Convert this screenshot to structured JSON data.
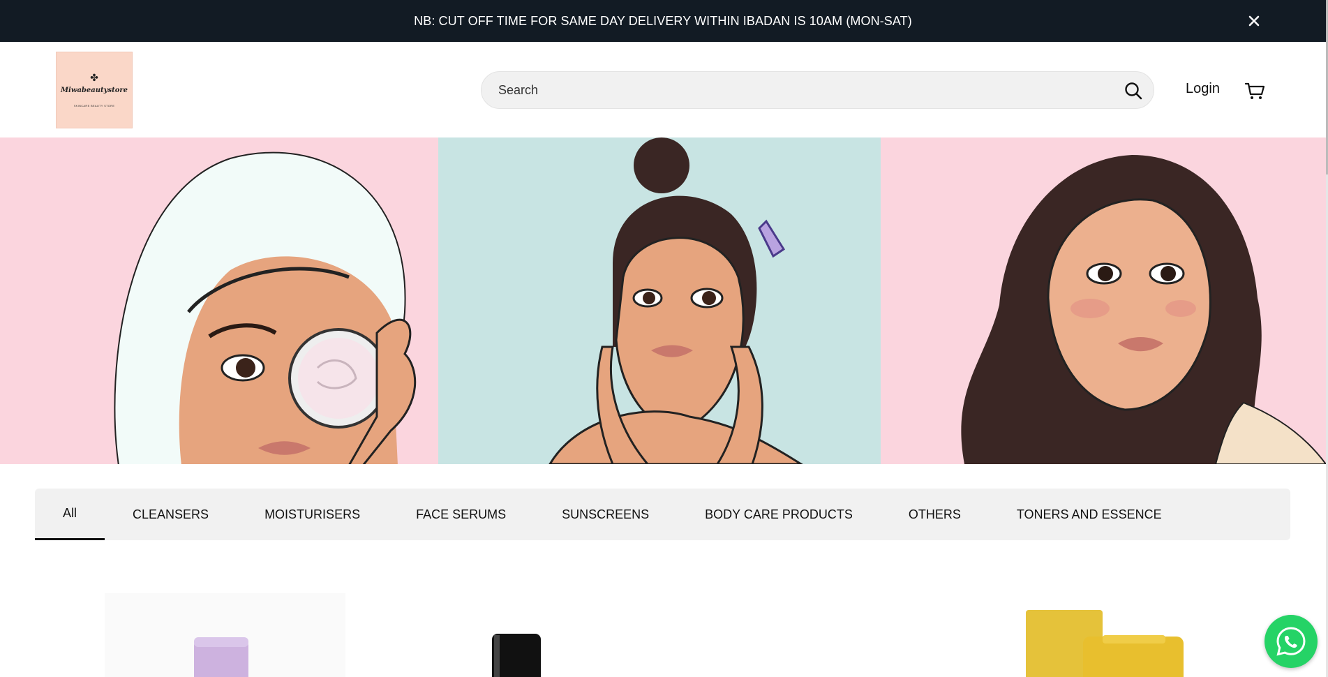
{
  "announcement": {
    "text": "NB: CUT OFF TIME FOR SAME DAY DELIVERY WITHIN IBADAN IS 10AM (MON-SAT)",
    "close_icon": "close-icon"
  },
  "header": {
    "logo": {
      "name": "Miwabeautystore",
      "tagline": "SKINCARE BEAUTY STORE"
    },
    "search": {
      "placeholder": "Search",
      "icon": "search-icon"
    },
    "login_label": "Login",
    "cart_icon": "cart-icon"
  },
  "hero": {
    "panels": [
      {
        "illustration": "woman-with-towel-holding-cream-jar",
        "background": "#fbd5de"
      },
      {
        "illustration": "woman-with-bun-touching-face",
        "background": "#c8e4e3"
      },
      {
        "illustration": "woman-with-long-wavy-hair",
        "background": "#fbd5de"
      }
    ]
  },
  "categories": {
    "active": "All",
    "items": [
      "All",
      "CLEANSERS",
      "MOISTURISERS",
      "FACE SERUMS",
      "SUNSCREENS",
      "BODY CARE PRODUCTS",
      "OTHERS",
      "TONERS AND ESSENCE"
    ]
  },
  "products": [
    {
      "image": "lilac-bottle"
    },
    {
      "image": "black-bottle"
    },
    {
      "image": "empty"
    },
    {
      "image": "facetheory-yellow-box-and-tube"
    }
  ],
  "whatsapp": {
    "icon": "whatsapp-icon"
  },
  "colors": {
    "announcement_bg": "#121b24",
    "hero_pink": "#fbd5de",
    "hero_teal": "#c8e4e3",
    "tab_bar_bg": "#f1f1f1",
    "whatsapp_green": "#25d366"
  }
}
